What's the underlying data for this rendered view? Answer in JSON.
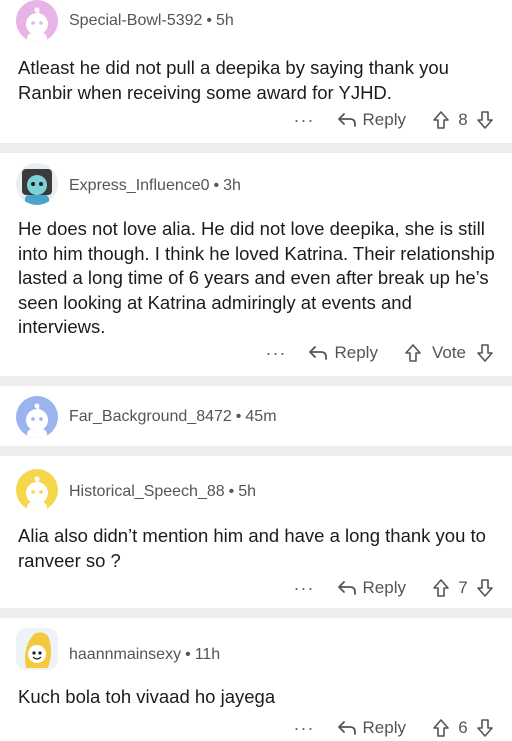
{
  "comments": [
    {
      "username": "Special-Bowl-5392",
      "time": "5h",
      "body": "Atleast he did not pull a deepika by saying thank you Ranbir when receiving some award for YJHD.",
      "more": "···",
      "reply": "Reply",
      "votes": "8",
      "avatar": "pink-snoo-avatar",
      "avatar_color": "#e8b3e6"
    },
    {
      "username": "Express_Influence0",
      "time": "3h",
      "body": "He does not love alia. He did not love deepika, she is still into him though. I think he loved Katrina. Their relationship lasted a long time of 6 years and even after break up he’s seen looking at Katrina admiringly at events and interviews.",
      "more": "···",
      "reply": "Reply",
      "votes": "Vote",
      "avatar": "custom-snoo-avatar",
      "avatar_color": "#7fd1d8"
    },
    {
      "username": "Far_Background_8472",
      "time": "45m",
      "avatar": "blue-snoo-avatar",
      "avatar_color": "#9bb3ef"
    },
    {
      "username": "Historical_Speech_88",
      "time": "5h",
      "body": "Alia also didn’t mention him and have a long thank you to ranveer so ?",
      "more": "···",
      "reply": "Reply",
      "votes": "7",
      "avatar": "yellow-snoo-avatar",
      "avatar_color": "#f6d64a"
    },
    {
      "username": "haannmainsexy",
      "time": "11h",
      "body": "Kuch bola toh vivaad ho jayega",
      "more": "···",
      "reply": "Reply",
      "votes": "6",
      "avatar": "banana-snoo-avatar",
      "avatar_color": "#f5c842"
    }
  ],
  "colors": {
    "separator": "#ededed",
    "meta": "#555555",
    "text": "#1c1c1c"
  }
}
